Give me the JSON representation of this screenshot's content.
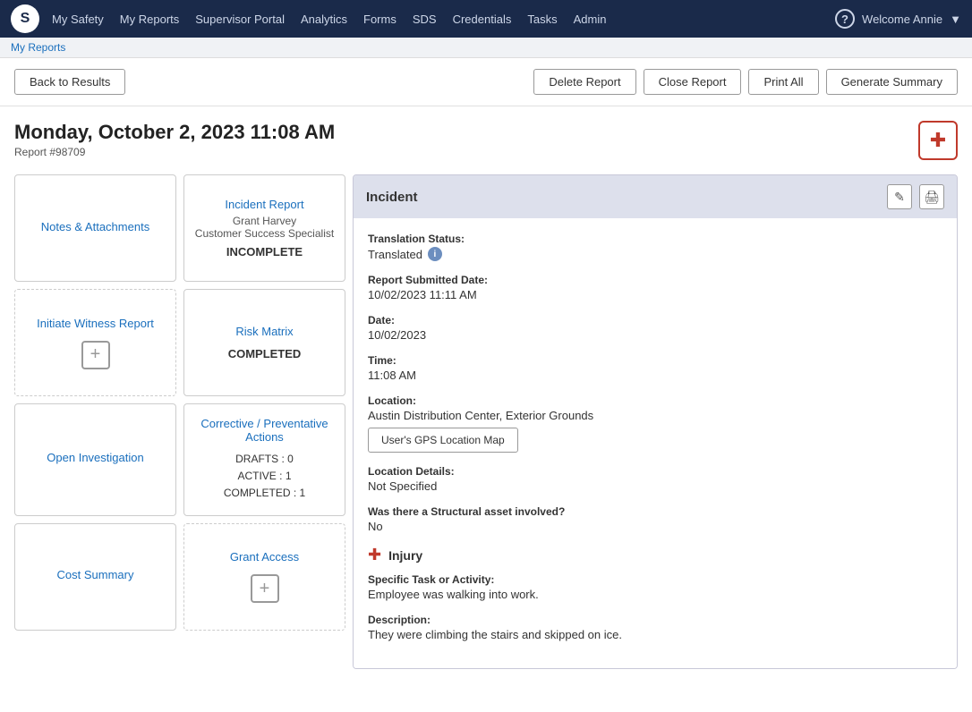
{
  "app": {
    "logo": "S",
    "nav_links": [
      "My Safety",
      "My Reports",
      "Supervisor Portal",
      "Analytics",
      "Forms",
      "SDS",
      "Credentials",
      "Tasks",
      "Admin"
    ],
    "welcome": "Welcome Annie"
  },
  "breadcrumb": {
    "item": "My Reports"
  },
  "toolbar": {
    "back_label": "Back to Results",
    "delete_label": "Delete Report",
    "close_label": "Close Report",
    "print_label": "Print All",
    "generate_label": "Generate Summary"
  },
  "report": {
    "date": "Monday, October 2, 2023 11:08 AM",
    "number": "Report #98709"
  },
  "cards": [
    {
      "title": "Notes & Attachments",
      "subtitle": "",
      "status": "",
      "type": "plain"
    },
    {
      "title": "Incident Report",
      "subtitle1": "Grant Harvey",
      "subtitle2": "Customer Success Specialist",
      "status": "INCOMPLETE",
      "type": "status"
    },
    {
      "title": "Initiate Witness Report",
      "subtitle": "",
      "status": "",
      "type": "add"
    },
    {
      "title": "Risk Matrix",
      "subtitle": "",
      "status": "COMPLETED",
      "type": "status-only"
    },
    {
      "title": "Open Investigation",
      "subtitle": "",
      "status": "",
      "type": "plain"
    },
    {
      "title": "Corrective / Preventative Actions",
      "drafts": "DRAFTS : 0",
      "active": "ACTIVE : 1",
      "completed": "COMPLETED : 1",
      "type": "drafts"
    },
    {
      "title": "Cost Summary",
      "subtitle": "",
      "status": "",
      "type": "plain"
    },
    {
      "title": "Grant Access",
      "subtitle": "",
      "status": "",
      "type": "add"
    }
  ],
  "incident_panel": {
    "title": "Incident",
    "fields": {
      "translation_status_label": "Translation Status:",
      "translation_status_value": "Translated",
      "report_submitted_label": "Report Submitted Date:",
      "report_submitted_value": "10/02/2023 11:11 AM",
      "date_label": "Date:",
      "date_value": "10/02/2023",
      "time_label": "Time:",
      "time_value": "11:08 AM",
      "location_label": "Location:",
      "location_value": "Austin Distribution Center, Exterior Grounds",
      "gps_button": "User's GPS Location Map",
      "location_details_label": "Location Details:",
      "location_details_value": "Not Specified",
      "structural_label": "Was there a Structural asset involved?",
      "structural_value": "No",
      "injury_section": "Injury",
      "specific_task_label": "Specific Task or Activity:",
      "specific_task_value": "Employee was walking into work.",
      "description_label": "Description:",
      "description_value": "They were climbing the stairs and skipped on ice."
    }
  }
}
